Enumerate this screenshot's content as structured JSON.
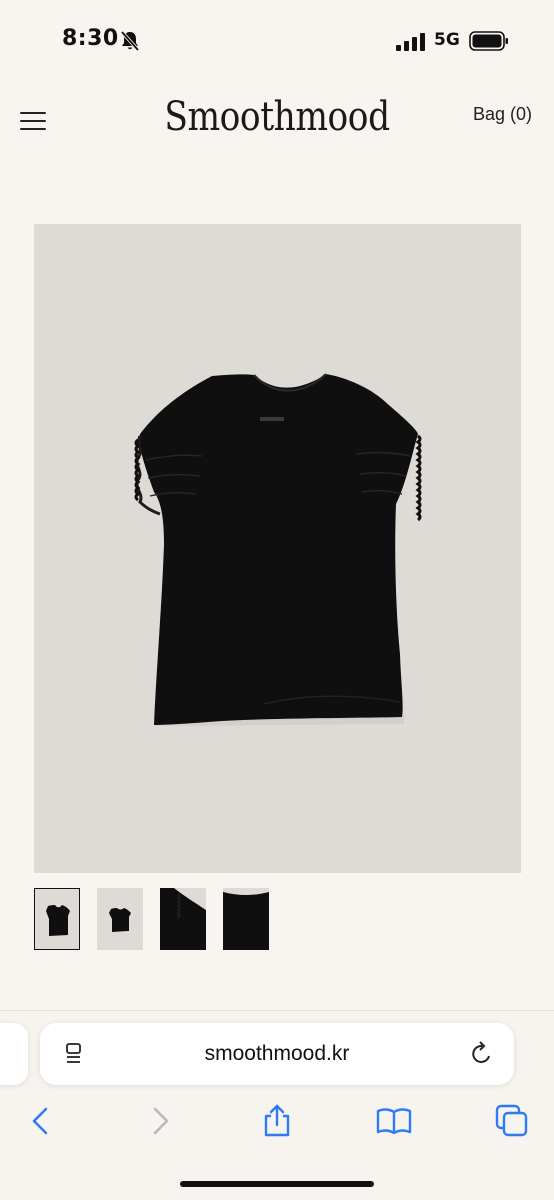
{
  "status_bar": {
    "time": "8:30",
    "network": "5G",
    "icons": [
      "bell-off-icon",
      "signal-icon",
      "battery-icon"
    ]
  },
  "header": {
    "brand": "Smoothmood",
    "bag_label": "Bag (0)",
    "menu_icon": "hamburger-menu-icon"
  },
  "product": {
    "main_image": "black-ruched-sleeve-top",
    "thumbnails": [
      {
        "name": "thumb-front-black-top",
        "selected": true
      },
      {
        "name": "thumb-front-black-top-small",
        "selected": false
      },
      {
        "name": "thumb-sleeve-detail",
        "selected": false
      },
      {
        "name": "thumb-fabric-closeup",
        "selected": false
      }
    ]
  },
  "browser": {
    "url": "smoothmood.kr",
    "toolbar": [
      "back-icon",
      "forward-icon",
      "share-icon",
      "bookmarks-icon",
      "tabs-icon"
    ]
  },
  "colors": {
    "page_background": "#f8f4ef",
    "image_background": "#dedbd6",
    "garment": "#0f0f0f",
    "link_blue": "#2f7bf5"
  }
}
